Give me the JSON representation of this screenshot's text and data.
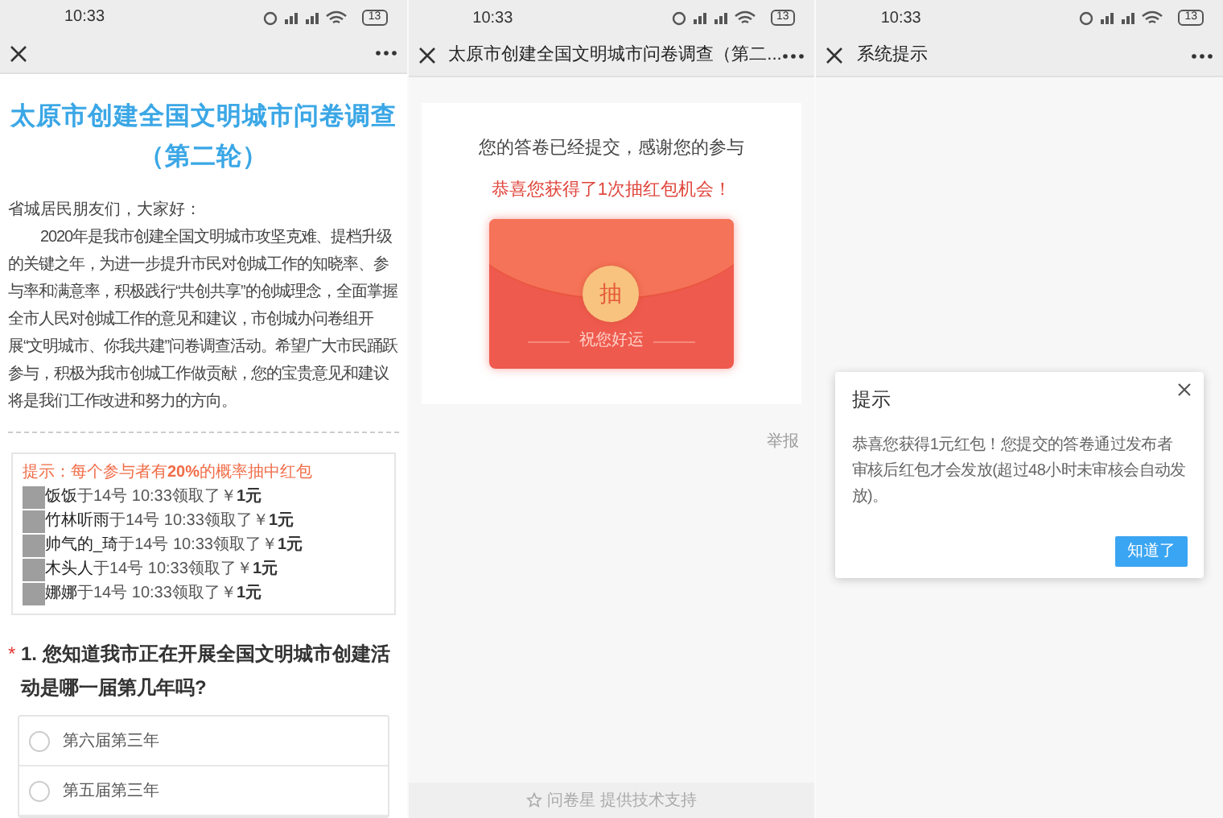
{
  "screens": [
    {
      "status_bar": {
        "time": "10:33",
        "battery": "13"
      },
      "survey": {
        "title": "太原市创建全国文明城市问卷调查（第二轮）",
        "greeting": "省城居民朋友们，大家好：",
        "intro": "2020年是我市创建全国文明城市攻坚克难、提档升级的关键之年，为进一步提升市民对创城工作的知晓率、参与率和满意率，积极践行“共创共享”的创城理念，全面掌握全市人民对创城工作的意见和建议，市创城办问卷组开展“文明城市、你我共建”问卷调查活动。希望广大市民踊跃参与，积极为我市创城工作做贡献，您的宝贵意见和建议将是我们工作改进和努力的方向。",
        "tip": "提示：每个参与者有**20%**的概率抽中红包",
        "winners": [
          {
            "name": "饭饭",
            "text": "于14号 10:33领取了￥",
            "amount": "1元"
          },
          {
            "name": "竹林听雨",
            "text": "于14号 10:33领取了￥",
            "amount": "1元"
          },
          {
            "name": "帅气的_琦",
            "text": "于14号 10:33领取了￥",
            "amount": "1元"
          },
          {
            "name": "木头人",
            "text": "于14号 10:33领取了￥",
            "amount": "1元"
          },
          {
            "name": "娜娜",
            "text": "于14号 10:33领取了￥",
            "amount": "1元"
          }
        ],
        "question": {
          "required_mark": "*",
          "text": "1. 您知道我市正在开展全国文明城市创建活动是哪一届第几年吗?",
          "options": [
            {
              "label": "第六届第三年",
              "selected": false
            },
            {
              "label": "第五届第三年",
              "selected": false
            }
          ]
        }
      }
    },
    {
      "status_bar": {
        "time": "10:33",
        "battery": "13"
      },
      "nav": {
        "title": "太原市创建全国文明城市问卷调查（第二..."
      },
      "result": {
        "message": "您的答卷已经提交，感谢您的参与",
        "congrats": "恭喜您获得了1次抽红包机会！",
        "draw_button": "抽",
        "envelope_caption": "祝您好运",
        "report": "举报",
        "footer": "问卷星 提供技术支持"
      }
    },
    {
      "status_bar": {
        "time": "10:33",
        "battery": "13"
      },
      "nav": {
        "title": "系统提示"
      },
      "dialog": {
        "title": "提示",
        "body": "恭喜您获得1元红包！您提交的答卷通过发布者审核后红包才会发放(超过48小时未审核会自动发放)。",
        "button": "知道了"
      }
    }
  ]
}
